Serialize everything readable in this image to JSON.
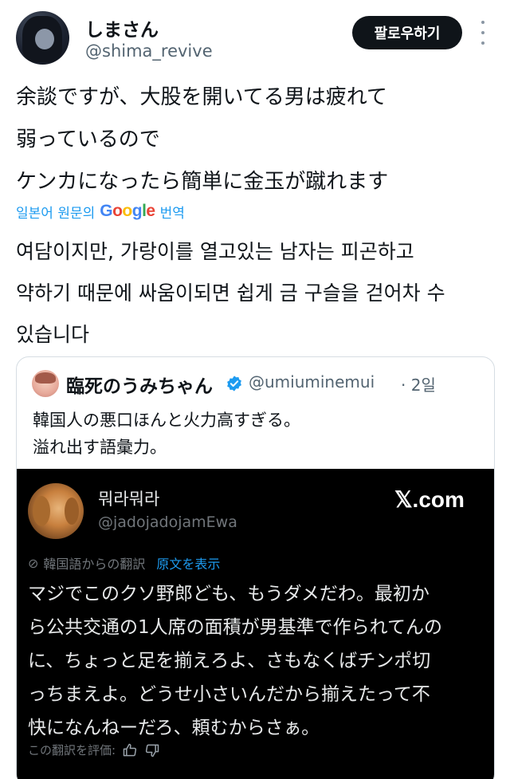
{
  "post": {
    "display_name": "しまさん",
    "handle": "@shima_revive",
    "follow_label": "팔로우하기",
    "more_icon": "more-vertical-icon",
    "text_lines": [
      "余談ですが、大股を開いてる男は疲れて",
      "弱っているので",
      "ケンカになったら簡単に金玉が蹴れます"
    ],
    "translate": {
      "label": "일본어 원문의",
      "provider": "Google",
      "action": "번역"
    },
    "translated_lines": [
      "여담이지만, 가랑이를 열고있는 남자는 피곤하고",
      "약하기 때문에 싸움이되면 쉽게 금 구슬을 걷어차 수",
      "있습니다"
    ]
  },
  "quote": {
    "display_name": "臨死のうみちゃん",
    "verified_icon": "verified-badge-icon",
    "verified_color": "#1d9bf0",
    "handle": "@umiuminemui",
    "time": "· 2일",
    "text_lines": [
      "韓国人の悪口ほんと火力高すぎる。",
      "溢れ出す語彙力。"
    ],
    "embed": {
      "display_name": "뭐라뭐라",
      "handle": "@jadojadojamEwa",
      "brand": "𝕏.com",
      "translate_icon": "globe-icon",
      "translate_from": "韓国語からの翻訳",
      "show_original": "原文を表示",
      "body_lines": [
        "マジでこのクソ野郎ども、もうダメだわ。最初か",
        "ら公共交通の1人席の面積が男基準で作られてんの",
        "に、ちょっと足を揃えろよ、さもなくばチンポ切",
        "っちまえよ。どうせ小さいんだから揃えたって不",
        "快になんねーだろ、頼むからさぁ。"
      ],
      "rate_label": "この翻訳を評価:",
      "thumb_up_icon": "thumbs-up-icon",
      "thumb_down_icon": "thumbs-down-icon"
    }
  },
  "colors": {
    "link_blue": "#1d9bf0",
    "text_primary": "#0f1419",
    "text_secondary": "#536471",
    "embed_bg": "#000000"
  }
}
